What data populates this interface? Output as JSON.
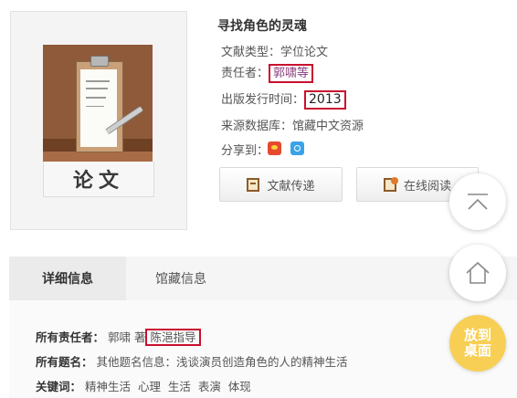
{
  "book": {
    "cover_label": "论文",
    "title": "寻找角色的灵魂",
    "doc_type_label": "文献类型：",
    "doc_type_value": "学位论文",
    "responsible_label": "责任者：",
    "responsible_value": "郭啸等",
    "pub_time_label": "出版发行时间：",
    "pub_time_value": "2013",
    "source_label": "来源数据库：",
    "source_value": "馆藏中文资源",
    "share_label": "分享到："
  },
  "actions": {
    "send_label": "文献传递",
    "read_label": "在线阅读"
  },
  "tabs": [
    {
      "label": "详细信息",
      "active": true
    },
    {
      "label": "馆藏信息",
      "active": false
    }
  ],
  "details": {
    "all_responsible_label": "所有责任者：",
    "all_responsible_author": "郭啸 著",
    "all_responsible_advisor": "陈浥指导",
    "all_titles_label": "所有题名：",
    "all_titles_value": "其他题名信息：浅谈演员创造角色的人的精神生活",
    "keywords_label": "关键词：",
    "keywords_value": "精神生活  心理  生活  表演  体现"
  },
  "floating": {
    "desk_line1": "放到",
    "desk_line2": "桌面"
  },
  "colors": {
    "highlight_box": "#c8102e",
    "link": "#8b3e7c",
    "desk_button": "#f7cf55"
  }
}
